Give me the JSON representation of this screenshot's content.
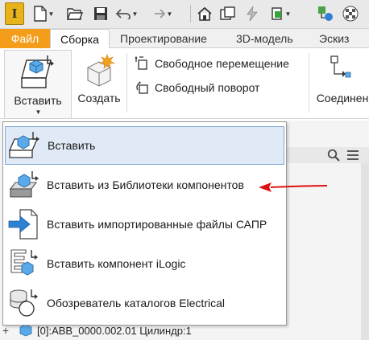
{
  "app": {
    "logo_letter": "I"
  },
  "ribbon_tabs": {
    "file": "Файл",
    "assembly": "Сборка",
    "design": "Проектирование",
    "model3d": "3D-модель",
    "sketch": "Эскиз"
  },
  "ribbon": {
    "insert_label": "Вставить",
    "create_label": "Создать",
    "free_move": "Свободное перемещение",
    "free_rotate": "Свободный поворот",
    "connect_label": "Соединен"
  },
  "menu": {
    "items": [
      {
        "label": "Вставить",
        "icon": "insert-component-icon"
      },
      {
        "label": "Вставить из Библиотеки компонентов",
        "icon": "content-center-icon"
      },
      {
        "label": "Вставить импортированные файлы САПР",
        "icon": "import-cad-icon"
      },
      {
        "label": "Вставить компонент iLogic",
        "icon": "ilogic-component-icon"
      },
      {
        "label": "Обозреватель  каталогов Electrical",
        "icon": "electrical-catalog-icon"
      }
    ]
  },
  "browser": {
    "tree_row": "[0]:ABB_0000.002.01 Цилиндр:1"
  },
  "colors": {
    "accent": "#f49d1b",
    "highlight_arrow": "#e01010",
    "selection": "#dfeaf6"
  }
}
